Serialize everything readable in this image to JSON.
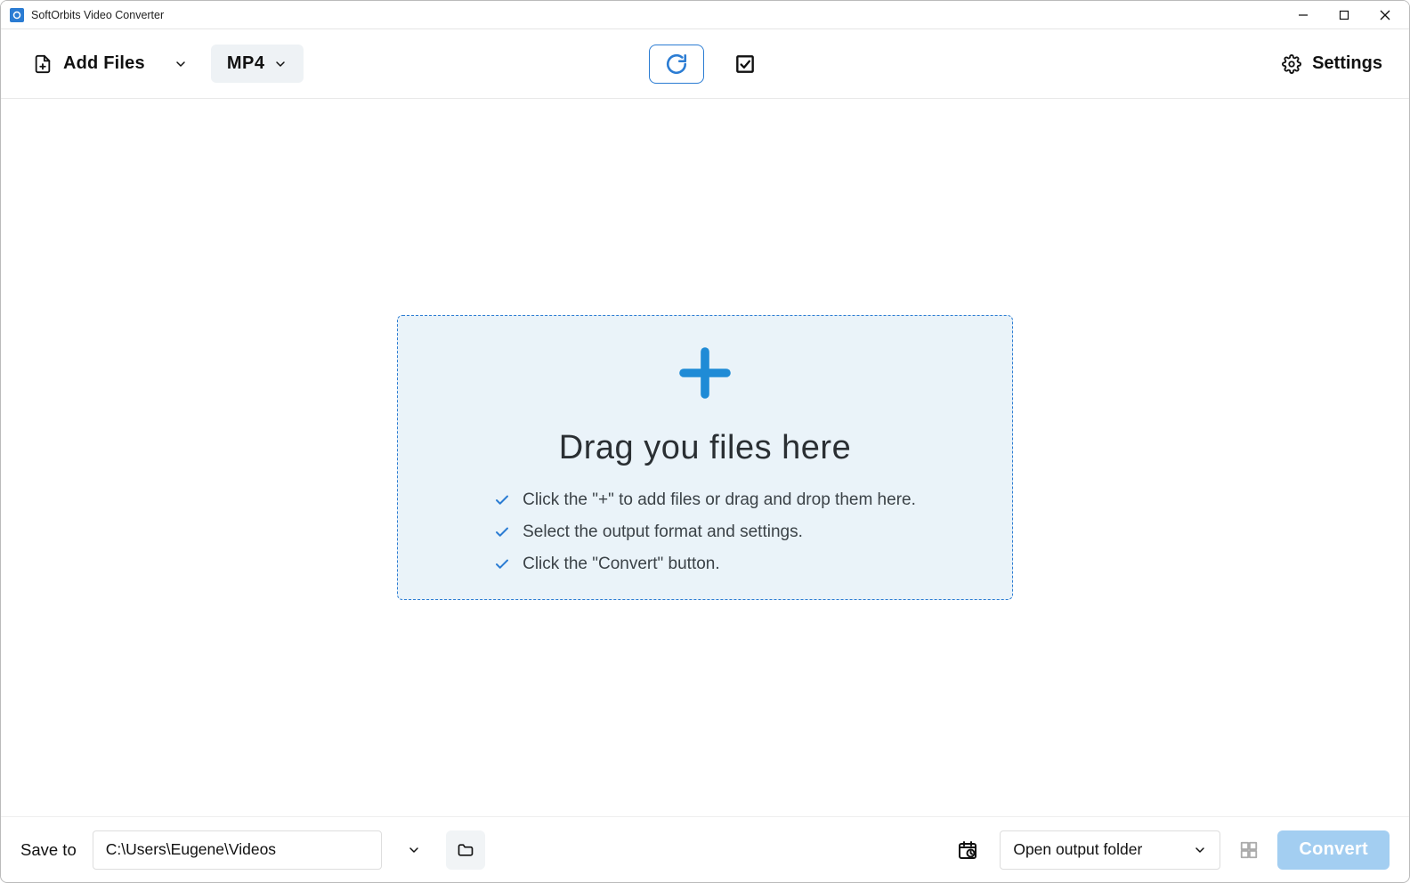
{
  "titlebar": {
    "title": "SoftOrbits Video Converter"
  },
  "toolbar": {
    "add_files_label": "Add Files",
    "format_label": "MP4",
    "settings_label": "Settings"
  },
  "dropzone": {
    "heading": "Drag you files here",
    "steps": [
      "Click the \"+\" to add files or drag and drop them here.",
      "Select the output format and settings.",
      "Click the \"Convert\" button."
    ]
  },
  "bottombar": {
    "saveto_label": "Save to",
    "path": "C:\\Users\\Eugene\\Videos",
    "open_output_label": "Open output folder",
    "convert_label": "Convert"
  },
  "colors": {
    "accent": "#2b7cd3"
  }
}
